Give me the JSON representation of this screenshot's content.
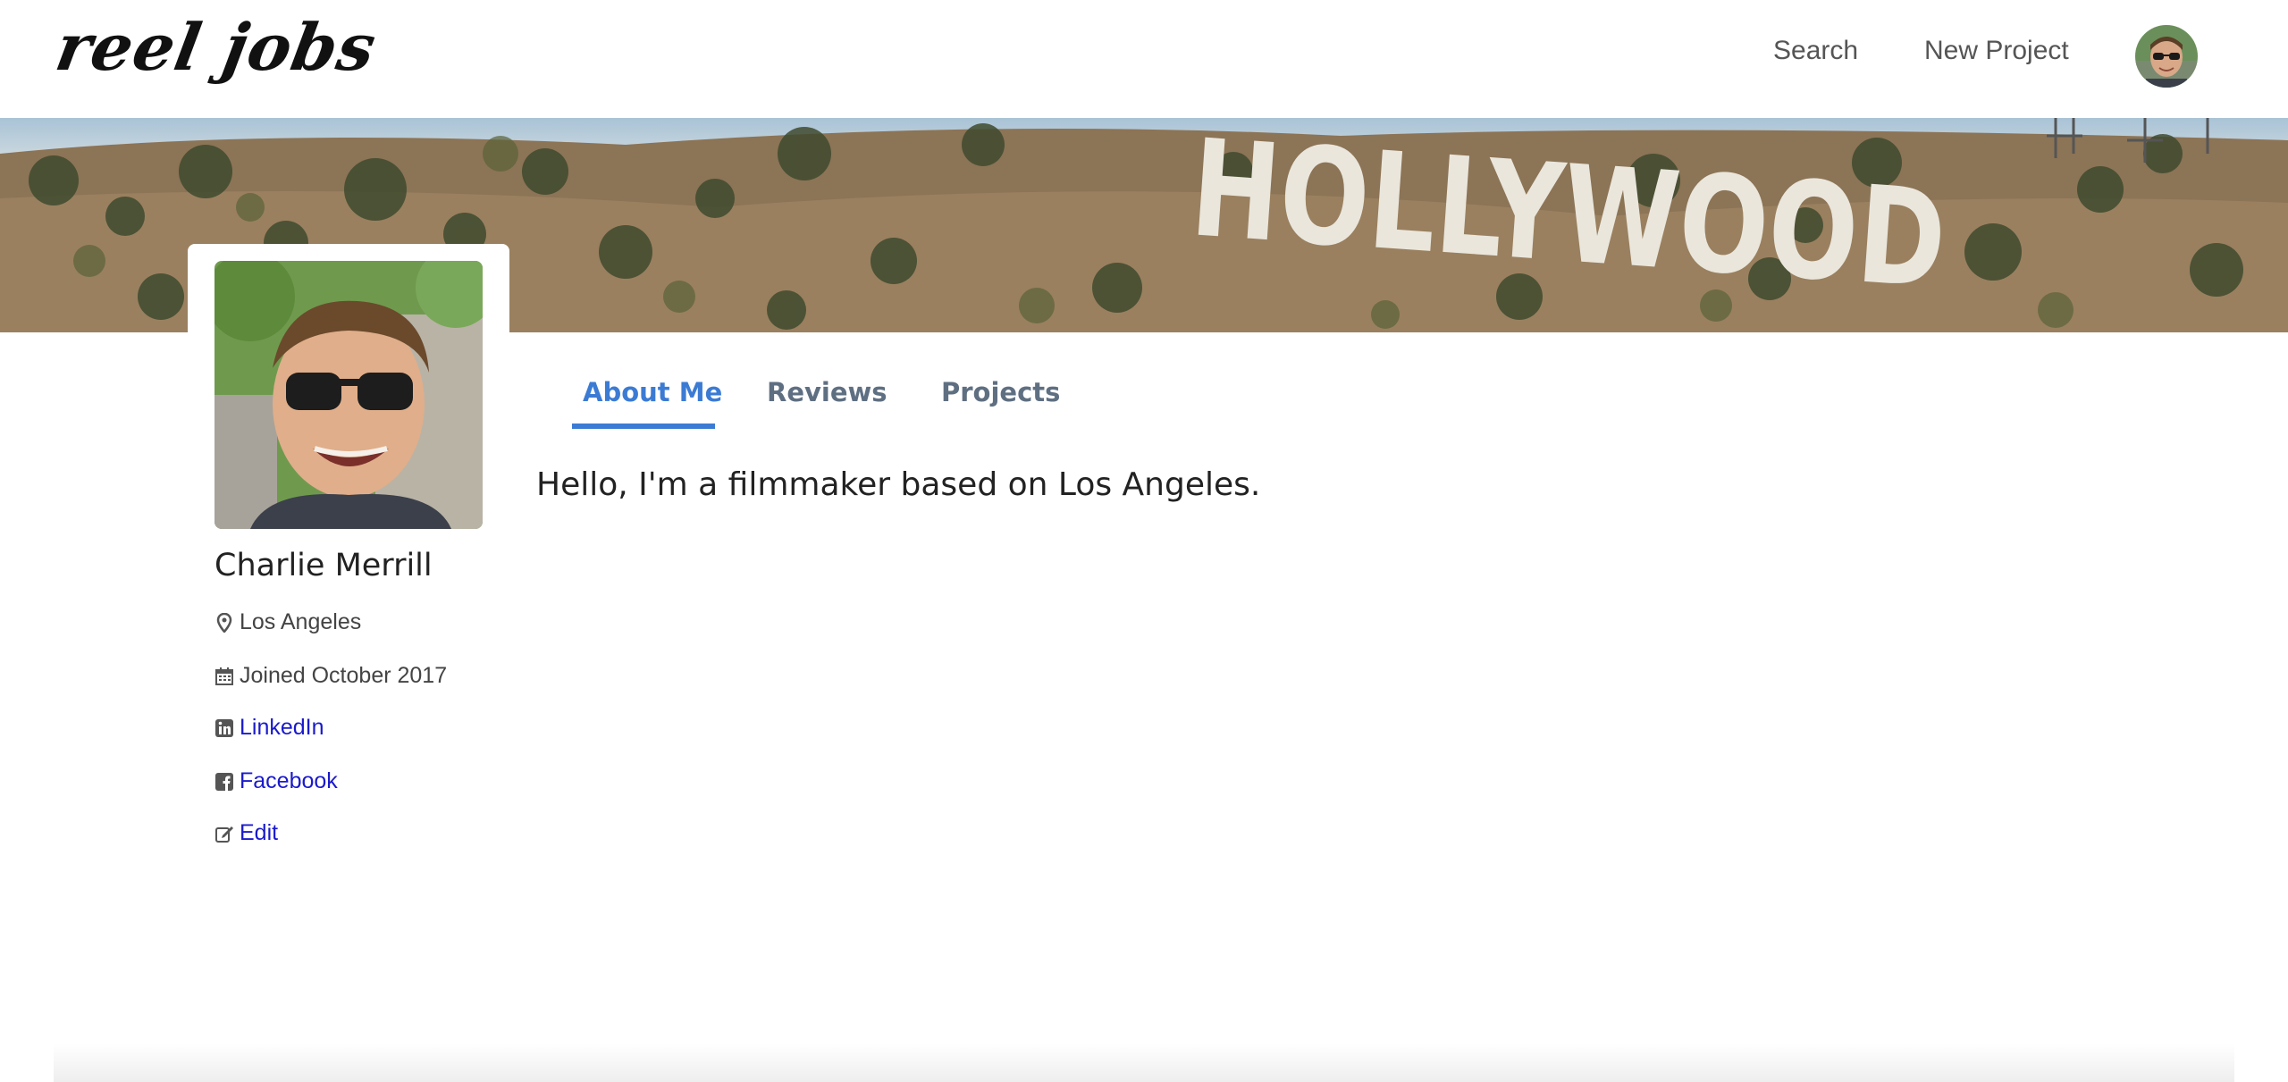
{
  "brand": {
    "name": "reel jobs"
  },
  "nav": {
    "search_label": "Search",
    "new_project_label": "New Project"
  },
  "banner": {
    "sign_text": "HOLLYWOOD"
  },
  "profile": {
    "name": "Charlie Merrill",
    "location": "Los Angeles",
    "joined": "Joined October 2017",
    "linkedin_label": "LinkedIn",
    "facebook_label": "Facebook",
    "edit_label": "Edit"
  },
  "tabs": [
    {
      "label": "About Me",
      "active": true
    },
    {
      "label": "Reviews",
      "active": false
    },
    {
      "label": "Projects",
      "active": false
    }
  ],
  "about": {
    "text": "Hello, I'm a filmmaker based on Los Angeles."
  },
  "colors": {
    "accent": "#3b7bd4",
    "link": "#1a1acc",
    "tab_inactive": "#5f6f82"
  },
  "icons": {
    "location": "map-marker-icon",
    "joined": "calendar-icon",
    "linkedin": "linkedin-icon",
    "facebook": "facebook-icon",
    "edit": "edit-icon"
  }
}
